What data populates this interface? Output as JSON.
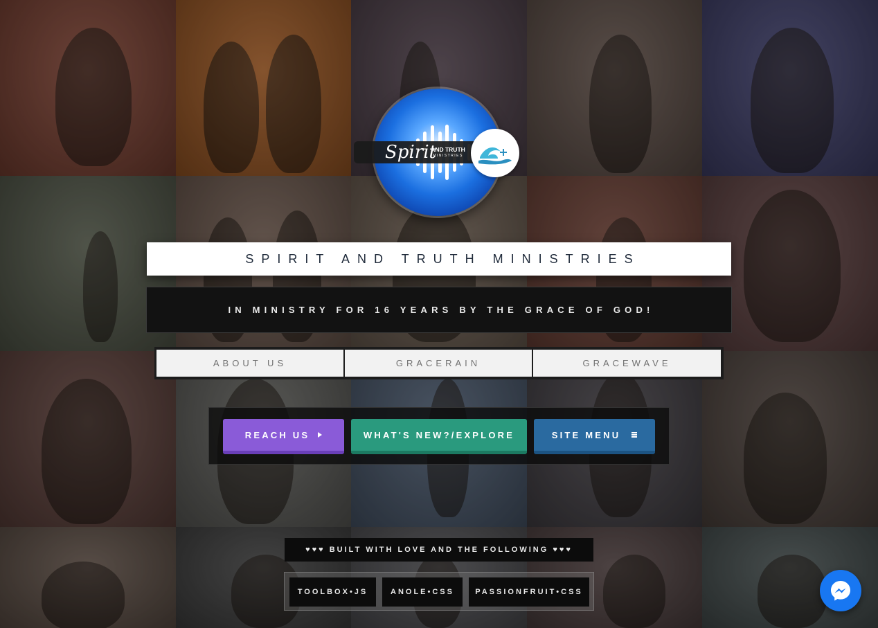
{
  "logo": {
    "script_text": "Spirit",
    "small_text": "AND TRUTH",
    "small_sub": "MINISTRIES"
  },
  "title": "SPIRIT AND TRUTH MINISTRIES",
  "tagline": "IN MINISTRY FOR 16 YEARS BY THE GRACE OF GOD!",
  "tabs": [
    {
      "label": "ABOUT US"
    },
    {
      "label": "GRACERAIN"
    },
    {
      "label": "GRACEWAVE"
    }
  ],
  "actions": {
    "reach_us": "REACH US",
    "whats_new": "WHAT'S NEW?/EXPLORE",
    "site_menu": "SITE MENU"
  },
  "footer": {
    "built_with": "♥♥♥ BUILT WITH LOVE AND THE FOLLOWING ♥♥♥",
    "tech": [
      "TOOLBOX•JS",
      "ANOLE•CSS",
      "PASSIONFRUIT•CSS"
    ]
  },
  "colors": {
    "reach_us": "#8a5bd8",
    "whats_new": "#2a9a7e",
    "site_menu": "#2a6aa0",
    "messenger": "#1877f2"
  },
  "icons": {
    "reach_us": "triangle-right-icon",
    "site_menu": "hamburger-menu-icon",
    "chat": "facebook-messenger-icon"
  }
}
